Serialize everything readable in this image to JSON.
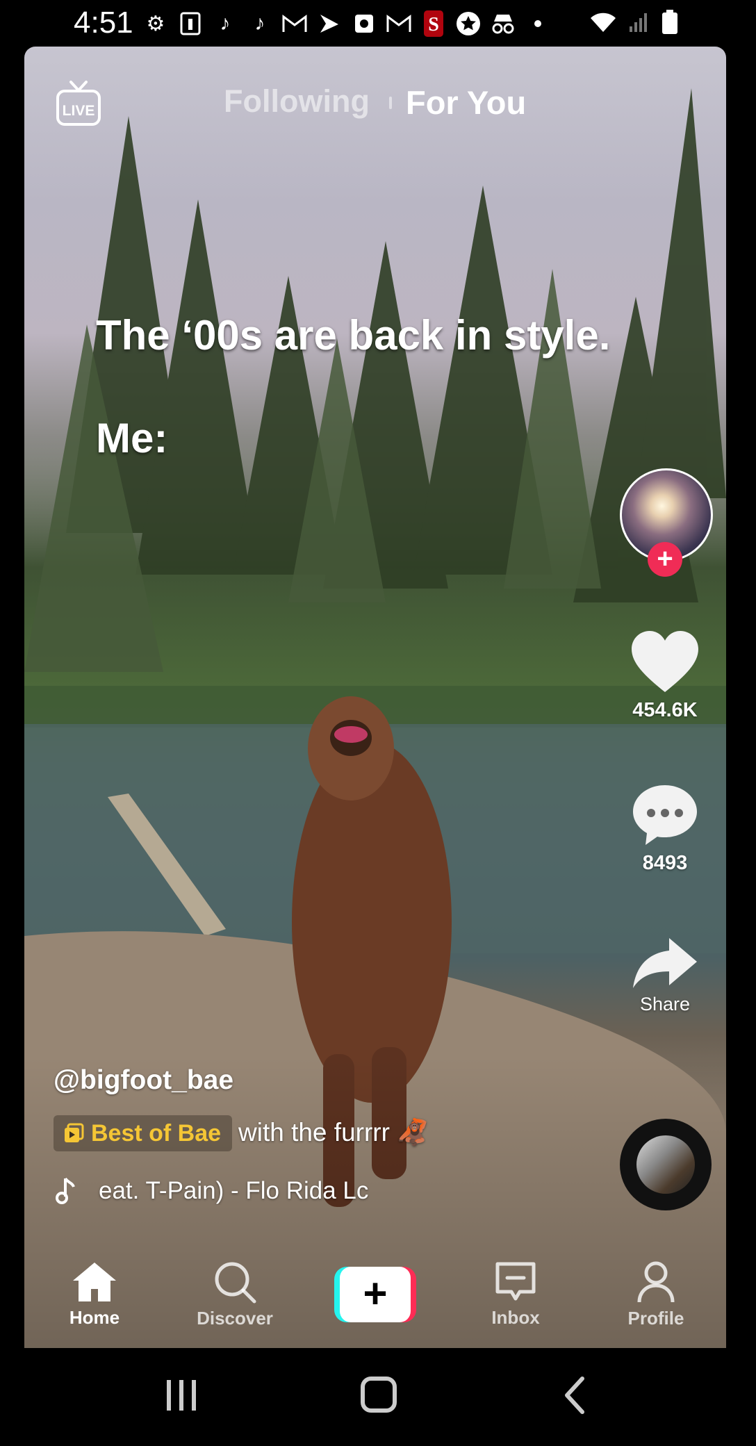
{
  "status_bar": {
    "time": "4:51",
    "icons": [
      "gear-icon",
      "contact-card-icon",
      "tiktok-icon",
      "tiktok-icon",
      "gmail-icon",
      "sprint-icon",
      "clock-app-icon",
      "gmail-icon",
      "stanford-icon",
      "star-icon",
      "incognito-icon",
      "dot-icon"
    ],
    "right_icons": [
      "wifi-icon",
      "signal-icon",
      "battery-icon"
    ]
  },
  "top_tabs": {
    "live": "LIVE",
    "following": "Following",
    "for_you": "For You"
  },
  "caption": {
    "line1": "The ‘00s are back in style.",
    "line2": "Me:"
  },
  "rail": {
    "likes": "454.6K",
    "comments": "8493",
    "share": "Share"
  },
  "post": {
    "username": "@bigfoot_bae",
    "playlist": "Best of Bae",
    "description": "with the furrrr 🦧",
    "music": "eat. T-Pain) - Flo Rida    Lc"
  },
  "nav": {
    "home": "Home",
    "discover": "Discover",
    "create": "+",
    "inbox": "Inbox",
    "profile": "Profile"
  },
  "colors": {
    "accent_red": "#fe2c55",
    "accent_cyan": "#25f4ee",
    "playlist_yellow": "#f5c635"
  }
}
